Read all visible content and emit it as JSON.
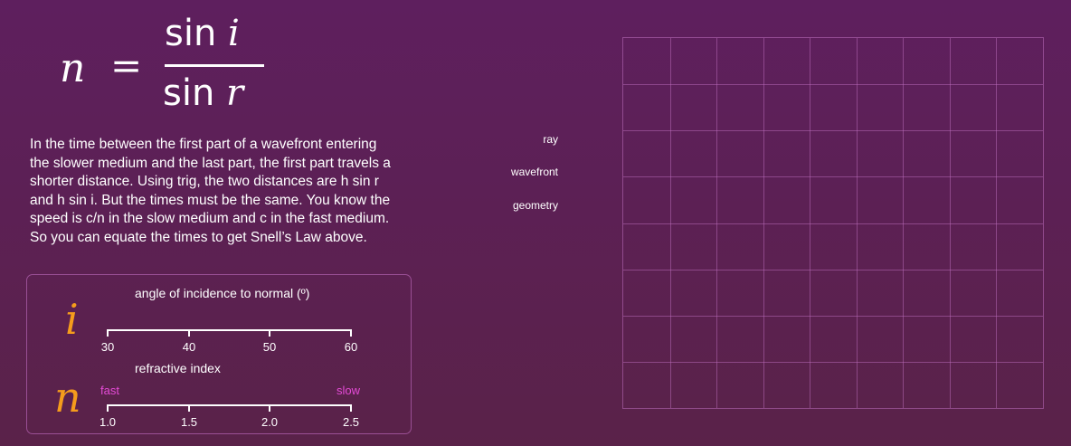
{
  "equation": {
    "lhs": "n",
    "equals": "=",
    "numerator_fn": "sin",
    "numerator_var": "i",
    "denominator_fn": "sin",
    "denominator_var": "r"
  },
  "explanation": [
    "In the time between the first part of a wavefront entering",
    "the slower medium and the last part, the first part travels a",
    "shorter distance.  Using trig, the two distances are h sin r",
    "and h sin i. But the times must be the same.  You know the",
    "speed is c/n in the slow medium and c in the fast medium.",
    "So you can equate the times to get Snell’s Law above."
  ],
  "controls": {
    "angle": {
      "symbol": "i",
      "label": "angle of incidence to normal (º)",
      "ticks": [
        "30",
        "40",
        "50",
        "60"
      ],
      "min": 30,
      "max": 60
    },
    "index": {
      "symbol": "n",
      "label": "refractive index",
      "ticks": [
        "1.0",
        "1.5",
        "2.0",
        "2.5"
      ],
      "min": 1.0,
      "max": 2.5,
      "left_note": "fast",
      "right_note": "slow"
    }
  },
  "options": [
    "ray",
    "wavefront",
    "geometry"
  ],
  "colors": {
    "symbol": "#f59c1c",
    "note": "#e44bd6",
    "background": "#5c2055"
  },
  "grid": {
    "columns": 9,
    "rows": 8
  }
}
